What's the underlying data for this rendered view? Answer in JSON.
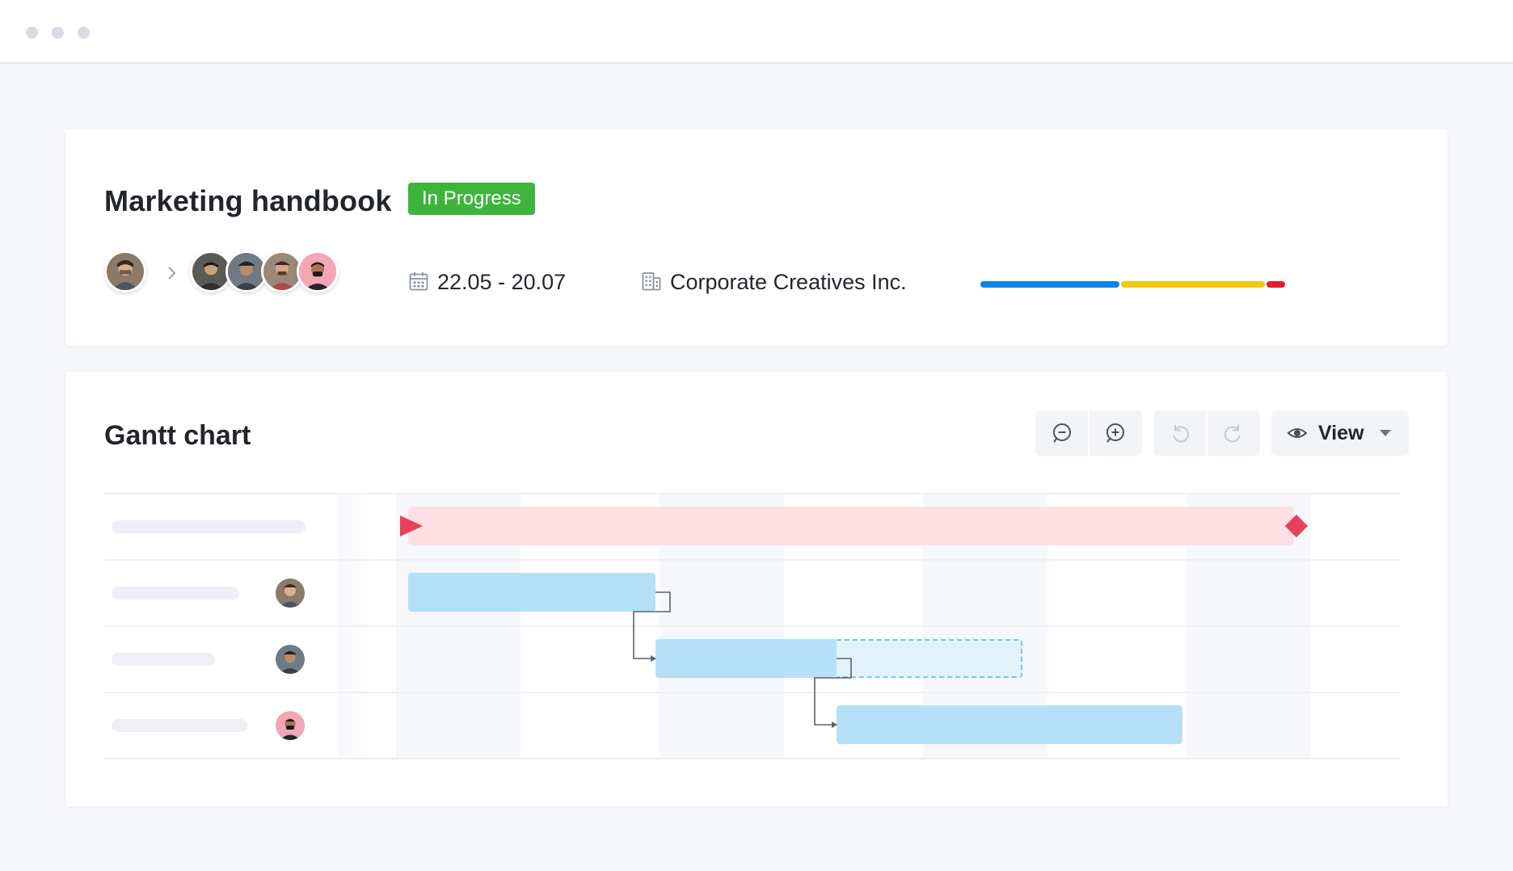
{
  "window": {
    "controls": [
      "close-dot",
      "minimize-dot",
      "maximize-dot"
    ]
  },
  "project": {
    "title": "Marketing handbook",
    "status": "In Progress",
    "status_color": "#3db53b",
    "owner_avatar": "avatar-owner",
    "team_avatars": [
      "avatar-member-1",
      "avatar-member-2",
      "avatar-member-3",
      "avatar-member-4"
    ],
    "date_icon": "calendar-icon",
    "date_range": "22.05 - 20.07",
    "company_icon": "building-icon",
    "company": "Corporate Creatives Inc.",
    "progress_segments": [
      {
        "color": "#0a84e0",
        "fraction": 0.46
      },
      {
        "color": "#f4c814",
        "fraction": 0.475
      },
      {
        "color": "#e21b2d",
        "fraction": 0.065
      }
    ]
  },
  "gantt": {
    "title": "Gantt chart",
    "toolbar": {
      "zoom_out_icon": "zoom-out-icon",
      "zoom_in_icon": "zoom-in-icon",
      "undo_icon": "undo-icon",
      "redo_icon": "redo-icon",
      "view_icon": "eye-icon",
      "view_label": "View"
    },
    "colors": {
      "project_bar": "#fddfe4",
      "milestone": "#e8405a",
      "task_bar": "#b6e0f7",
      "ghost_bar": "#e2f3fc"
    },
    "rows": [
      {
        "type": "project",
        "assignee": null
      },
      {
        "type": "task",
        "assignee": "avatar-owner"
      },
      {
        "type": "task",
        "assignee": "avatar-member-2"
      },
      {
        "type": "task",
        "assignee": "avatar-member-4"
      }
    ]
  }
}
